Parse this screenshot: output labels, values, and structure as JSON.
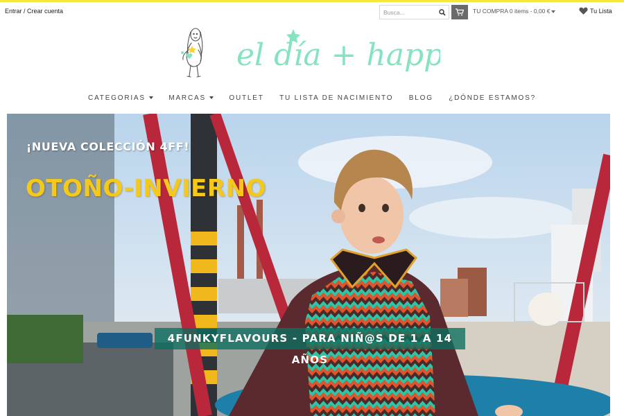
{
  "topbar": {
    "login_label": "Entrar / Crear cuenta",
    "search_placeholder": "Busca...",
    "cart_label": "TU COMPRA  0 items - 0,00 €",
    "wishlist_label": "Tu Lista"
  },
  "brand": {
    "logo_text": "el día + happy"
  },
  "nav": {
    "items": [
      {
        "label": "CATEGORIAS",
        "dropdown": true
      },
      {
        "label": "MARCAS",
        "dropdown": true
      },
      {
        "label": "OUTLET",
        "dropdown": false
      },
      {
        "label": "TU LISTA DE NACIMIENTO",
        "dropdown": false
      },
      {
        "label": "BLOG",
        "dropdown": false
      },
      {
        "label": "¿DÓNDE ESTAMOS?",
        "dropdown": false
      }
    ]
  },
  "hero": {
    "kicker": "¡NUEVA COLECCIÓN 4FF!",
    "title": "OTOÑO-INVIERNO",
    "band": "4FUNKYFLAVOURS - PARA NIÑ@S DE 1 A 14 AÑOS"
  },
  "colors": {
    "top_line": "#f5e83a",
    "logo_mint": "#86e3bf",
    "hero_title": "#f6c81a",
    "hero_band": "#0a6e5f",
    "cart_button": "#6b6b6b"
  },
  "icons": {
    "search": "search-icon",
    "cart": "cart-icon",
    "wishlist": "heart-icon",
    "logo": "girl-doodle-icon"
  }
}
